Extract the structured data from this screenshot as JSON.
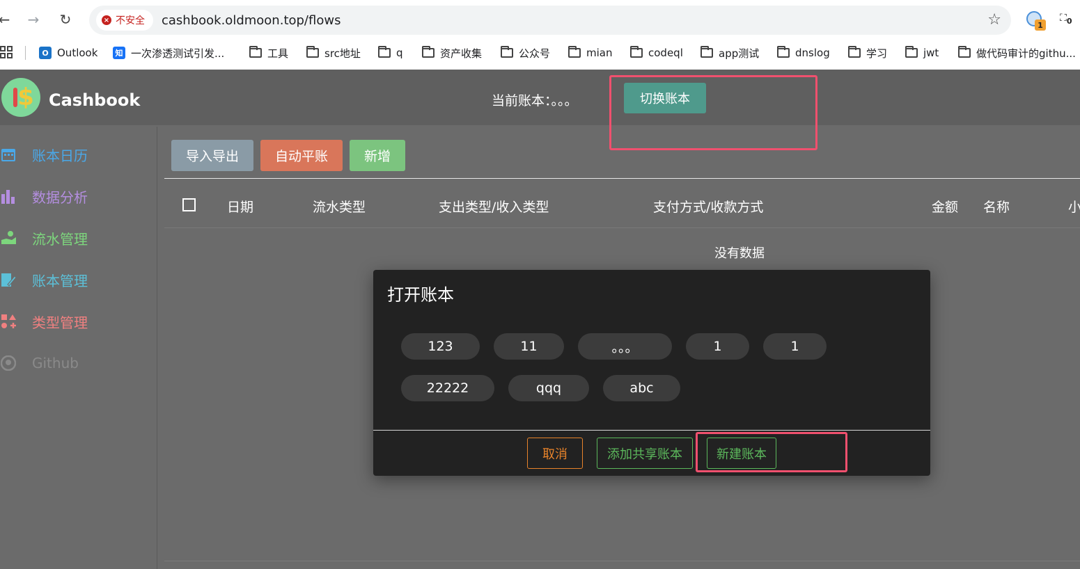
{
  "browser": {
    "insecure_label": "不安全",
    "url": "cashbook.oldmoon.top/flows",
    "bookmarks": [
      {
        "label": "Outlook",
        "icon": "outlook-icon"
      },
      {
        "label": "一次渗透测试引发...",
        "icon": "zhihu-icon"
      },
      {
        "label": "工具",
        "icon": "folder-icon"
      },
      {
        "label": "src地址",
        "icon": "folder-icon"
      },
      {
        "label": "q",
        "icon": "folder-icon"
      },
      {
        "label": "资产收集",
        "icon": "folder-icon"
      },
      {
        "label": "公众号",
        "icon": "folder-icon"
      },
      {
        "label": "mian",
        "icon": "folder-icon"
      },
      {
        "label": "codeql",
        "icon": "folder-icon"
      },
      {
        "label": "app测试",
        "icon": "folder-icon"
      },
      {
        "label": "dnslog",
        "icon": "folder-icon"
      },
      {
        "label": "学习",
        "icon": "folder-icon"
      },
      {
        "label": "jwt",
        "icon": "folder-icon"
      },
      {
        "label": "做代码审计的githu...",
        "icon": "folder-icon"
      }
    ],
    "zhihu_icon_text": "知",
    "extension_badge": "1",
    "extension_b_badge": "0"
  },
  "header": {
    "app_name": "Cashbook",
    "current_book_label": "当前账本：。。。",
    "switch_button": "切换账本"
  },
  "sidebar": {
    "items": [
      {
        "label": "账本日历",
        "icon": "calendar-icon",
        "color": "#4aa8e8"
      },
      {
        "label": "数据分析",
        "icon": "bar-chart-icon",
        "color": "#b48ee0"
      },
      {
        "label": "流水管理",
        "icon": "hand-money-icon",
        "color": "#7dd67d"
      },
      {
        "label": "账本管理",
        "icon": "book-edit-icon",
        "color": "#5cc0d8"
      },
      {
        "label": "类型管理",
        "icon": "shapes-icon",
        "color": "#f08080"
      },
      {
        "label": "Github",
        "icon": "github-icon",
        "color": "#8a8a8a"
      }
    ]
  },
  "toolbar": {
    "import_export": "导入导出",
    "auto_balance": "自动平账",
    "add": "新增",
    "import_export_color": "#8a9ba6",
    "auto_balance_color": "#d9765a",
    "add_color": "#7cc47f"
  },
  "table": {
    "columns": [
      "日期",
      "流水类型",
      "支出类型/收入类型",
      "支付方式/收款方式",
      "金额",
      "名称",
      "小"
    ],
    "empty_text": "没有数据"
  },
  "dialog": {
    "title": "打开账本",
    "books": [
      "123",
      "11",
      "。。。",
      "1",
      "1",
      "22222",
      "qqq",
      "abc"
    ],
    "cancel": "取消",
    "add_shared": "添加共享账本",
    "create_new": "新建账本",
    "cancel_color": "#e8832a",
    "green_color": "#5cb85c"
  },
  "annotation_color": "#f0506e"
}
